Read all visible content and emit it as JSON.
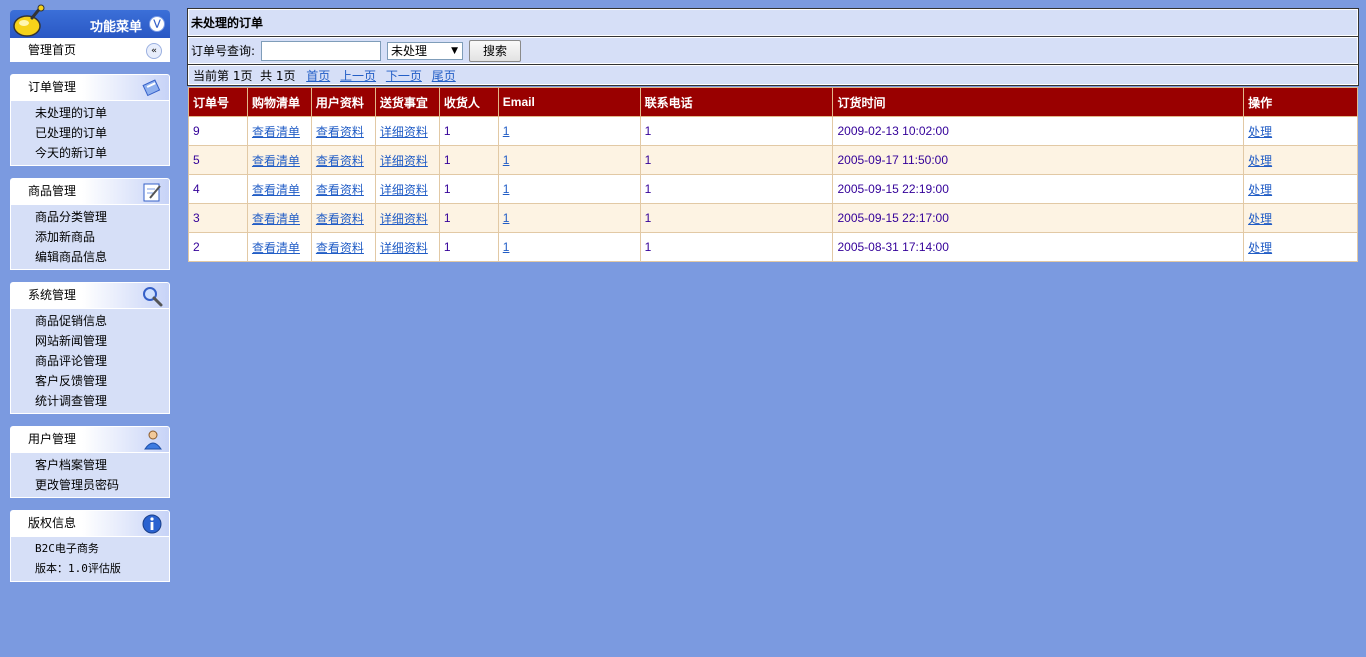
{
  "sidebar": {
    "menu_title": "功能菜单",
    "home": "管理首页",
    "groups": [
      {
        "title": "订单管理",
        "icon": "orders-icon",
        "items": [
          "未处理的订单",
          "已处理的订单",
          "今天的新订单"
        ]
      },
      {
        "title": "商品管理",
        "icon": "edit-icon",
        "items": [
          "商品分类管理",
          "添加新商品",
          "编辑商品信息"
        ]
      },
      {
        "title": "系统管理",
        "icon": "search-icon",
        "items": [
          "商品促销信息",
          "网站新闻管理",
          "商品评论管理",
          "客户反馈管理",
          "统计调查管理"
        ]
      },
      {
        "title": "用户管理",
        "icon": "user-icon",
        "items": [
          "客户档案管理",
          "更改管理员密码"
        ]
      },
      {
        "title": "版权信息",
        "icon": "info-icon",
        "items": [
          "B2C电子商务",
          "版本：1.0评估版"
        ]
      }
    ]
  },
  "main": {
    "title": "未处理的订单",
    "search": {
      "label": "订单号查询:",
      "value": "",
      "status_selected": "未处理",
      "button": "搜索"
    },
    "pager": {
      "current": "当前第 1页",
      "total": "共 1页",
      "first": "首页",
      "prev": "上一页",
      "next": "下一页",
      "last": "尾页"
    },
    "table": {
      "headers": [
        "订单号",
        "购物清单",
        "用户资料",
        "送货事宜",
        "收货人",
        "Email",
        "联系电话",
        "订货时间",
        "操作"
      ],
      "rows": [
        {
          "id": "9",
          "list": "查看清单",
          "user": "查看资料",
          "ship": "详细资料",
          "receiver": "1",
          "email": "1",
          "phone": "1",
          "time": "2009-02-13 10:02:00",
          "action": "处理"
        },
        {
          "id": "5",
          "list": "查看清单",
          "user": "查看资料",
          "ship": "详细资料",
          "receiver": "1",
          "email": "1",
          "phone": "1",
          "time": "2005-09-17 11:50:00",
          "action": "处理"
        },
        {
          "id": "4",
          "list": "查看清单",
          "user": "查看资料",
          "ship": "详细资料",
          "receiver": "1",
          "email": "1",
          "phone": "1",
          "time": "2005-09-15 22:19:00",
          "action": "处理"
        },
        {
          "id": "3",
          "list": "查看清单",
          "user": "查看资料",
          "ship": "详细资料",
          "receiver": "1",
          "email": "1",
          "phone": "1",
          "time": "2005-09-15 22:17:00",
          "action": "处理"
        },
        {
          "id": "2",
          "list": "查看清单",
          "user": "查看资料",
          "ship": "详细资料",
          "receiver": "1",
          "email": "1",
          "phone": "1",
          "time": "2005-08-31 17:14:00",
          "action": "处理"
        }
      ]
    }
  },
  "colors": {
    "background": "#7b9ae0",
    "panel": "#d6dff7",
    "header_row": "#990000",
    "alt_row": "#fdf3e3",
    "link": "#215dc6"
  }
}
